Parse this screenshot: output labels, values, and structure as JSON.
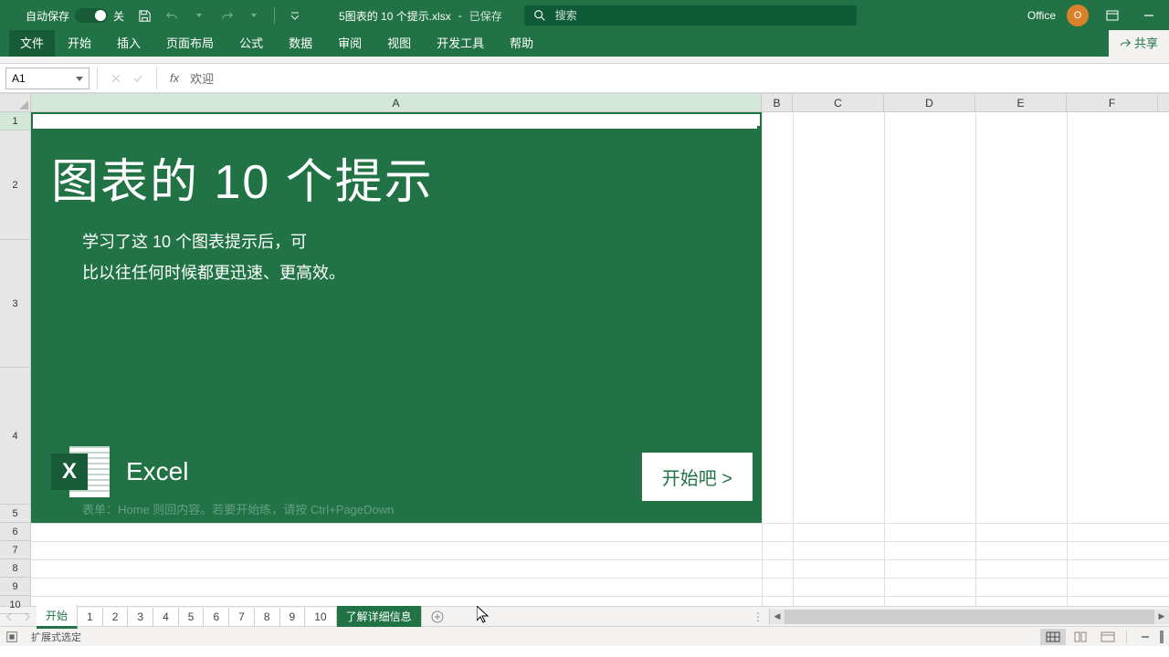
{
  "titlebar": {
    "autosave_label": "自动保存",
    "autosave_state": "关",
    "filename": "5图表的 10 个提示.xlsx",
    "saved_label": "已保存",
    "search_placeholder": "搜索",
    "office_label": "Office",
    "avatar_initial": "O"
  },
  "ribbon": {
    "file": "文件",
    "tabs": [
      "开始",
      "插入",
      "页面布局",
      "公式",
      "数据",
      "审阅",
      "视图",
      "开发工具",
      "帮助"
    ],
    "share": "共享"
  },
  "formula_bar": {
    "name_box": "A1",
    "formula_value": "欢迎"
  },
  "grid": {
    "columns": [
      "A",
      "B",
      "C",
      "D",
      "E",
      "F"
    ],
    "rows": [
      "1",
      "2",
      "3",
      "4",
      "5",
      "6",
      "7",
      "8",
      "9",
      "10"
    ],
    "banner": {
      "title": "图表的 10 个提示",
      "sub_line1": "学习了这 10 个图表提示后，可",
      "sub_line2": "比以往任何时候都更迅速、更高效。",
      "logo_letter": "X",
      "logo_label": "Excel",
      "start_button": "开始吧 >",
      "hint": "表单：Home 则回内容。若要开始练，请按 Ctrl+PageDown"
    }
  },
  "sheet_tabs": {
    "tabs": [
      "开始",
      "1",
      "2",
      "3",
      "4",
      "5",
      "6",
      "7",
      "8",
      "9",
      "10",
      "了解详细信息"
    ]
  },
  "statusbar": {
    "mode": "扩展式选定"
  }
}
